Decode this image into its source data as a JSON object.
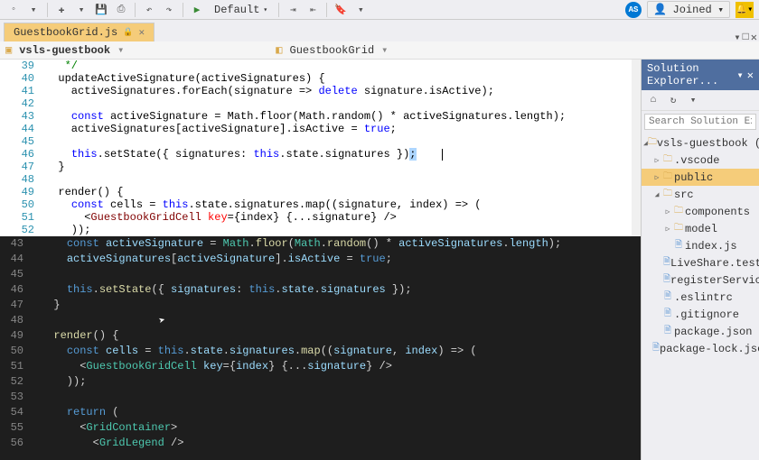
{
  "toolbar": {
    "debug_config": "Default",
    "joined_label": "Joined",
    "avatar_initials": "AS"
  },
  "tabs": {
    "active": "GuestbookGrid.js"
  },
  "breadcrumb": {
    "project": "vsls-guestbook",
    "symbol": "GuestbookGrid"
  },
  "explorer": {
    "title": "Solution Explorer...",
    "search_placeholder": "Search Solution Explorer",
    "root": "vsls-guestbook (C:\\User",
    "items": [
      {
        "label": ".vscode",
        "type": "folder",
        "indent": 1,
        "expanded": false
      },
      {
        "label": "public",
        "type": "folder",
        "indent": 1,
        "expanded": false,
        "selected": true
      },
      {
        "label": "src",
        "type": "folder",
        "indent": 1,
        "expanded": true
      },
      {
        "label": "components",
        "type": "folder",
        "indent": 2,
        "expanded": false
      },
      {
        "label": "model",
        "type": "folder",
        "indent": 2,
        "expanded": false
      },
      {
        "label": "index.js",
        "type": "file",
        "indent": 2
      },
      {
        "label": "LiveShare.test.js",
        "type": "file",
        "indent": 2
      },
      {
        "label": "registerServiceWor",
        "type": "file",
        "indent": 2
      },
      {
        "label": ".eslintrc",
        "type": "file",
        "indent": 1
      },
      {
        "label": ".gitignore",
        "type": "file",
        "indent": 1
      },
      {
        "label": "package.json",
        "type": "file",
        "indent": 1
      },
      {
        "label": "package-lock.json",
        "type": "file",
        "indent": 1
      }
    ]
  },
  "light_code": [
    {
      "n": 39,
      "html": "   <span class='comment'>*/</span>"
    },
    {
      "n": 40,
      "html": "  updateActiveSignature(activeSignatures) {"
    },
    {
      "n": 41,
      "html": "    activeSignatures.forEach(signature => <span class='kw'>delete</span> signature.isActive);"
    },
    {
      "n": 42,
      "html": ""
    },
    {
      "n": 43,
      "html": "    <span class='kw'>const</span> activeSignature = Math.floor(Math.random() * activeSignatures.length);"
    },
    {
      "n": 44,
      "html": "    activeSignatures[activeSignature].isActive = <span class='kw'>true</span>;"
    },
    {
      "n": 45,
      "html": ""
    },
    {
      "n": 46,
      "html": "    <span class='kw'>this</span>.setState({ signatures: <span class='kw'>this</span>.state.signatures })<span class='sel'>;</span>    <span class='cursor-mark'></span>"
    },
    {
      "n": 47,
      "html": "  }"
    },
    {
      "n": 48,
      "html": ""
    },
    {
      "n": 49,
      "html": "  render() {"
    },
    {
      "n": 50,
      "html": "    <span class='kw'>const</span> cells = <span class='kw'>this</span>.state.signatures.map((signature, index) => ("
    },
    {
      "n": 51,
      "html": "      &lt;<span class='jsx'>GuestbookGridCell</span> <span class='attr'>key</span>={index} {...signature} /&gt;"
    },
    {
      "n": 52,
      "html": "    ));"
    }
  ],
  "dark_code": [
    {
      "n": 43,
      "html": "    <span class='kw'>const</span> <span class='id'>activeSignature</span> = <span class='ty'>Math</span>.<span class='fn'>floor</span>(<span class='ty'>Math</span>.<span class='fn'>random</span>() * <span class='id'>activeSignatures</span>.<span class='id'>length</span>);"
    },
    {
      "n": 44,
      "html": "    <span class='id'>activeSignatures</span>[<span class='id'>activeSignature</span>].<span class='id'>isActive</span> = <span class='kw'>true</span>;"
    },
    {
      "n": 45,
      "html": ""
    },
    {
      "n": 46,
      "html": "    <span class='kw'>this</span>.<span class='fn'>setState</span>({ <span class='id'>signatures</span>: <span class='kw'>this</span>.<span class='id'>state</span>.<span class='id'>signatures</span> });"
    },
    {
      "n": 47,
      "html": "  }"
    },
    {
      "n": 48,
      "html": ""
    },
    {
      "n": 49,
      "html": "  <span class='fn'>render</span>() {"
    },
    {
      "n": 50,
      "html": "    <span class='kw'>const</span> <span class='id'>cells</span> = <span class='kw'>this</span>.<span class='id'>state</span>.<span class='id'>signatures</span>.<span class='fn'>map</span>((<span class='id'>signature</span>, <span class='id'>index</span>) =&gt; ("
    },
    {
      "n": 51,
      "html": "      &lt;<span class='jsx'>GuestbookGridCell</span> <span class='attr'>key</span>={<span class='id'>index</span>} {...<span class='id'>signature</span>} /&gt;"
    },
    {
      "n": 52,
      "html": "    ));"
    },
    {
      "n": 53,
      "html": ""
    },
    {
      "n": 54,
      "html": "    <span class='kw'>return</span> ("
    },
    {
      "n": 55,
      "html": "      &lt;<span class='jsx'>GridContainer</span>&gt;"
    },
    {
      "n": 56,
      "html": "        &lt;<span class='jsx'>GridLegend</span> /&gt;"
    }
  ]
}
